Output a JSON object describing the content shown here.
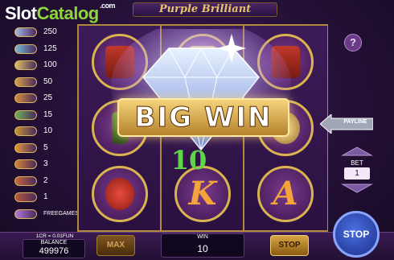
{
  "brand": {
    "slot": "Slot",
    "catalog": "Catalog",
    "com": ".com"
  },
  "game_title": "Purple Brilliant",
  "paytable": [
    {
      "value": "250",
      "icon": "diamond-bar-icon",
      "color": "#a8b8e8"
    },
    {
      "value": "125",
      "icon": "emerald-bar-icon",
      "color": "#7bbbd8"
    },
    {
      "value": "100",
      "icon": "crown-coin-icon",
      "color": "#e0c06a"
    },
    {
      "value": "50",
      "icon": "ring-coin-icon",
      "color": "#d9a44a"
    },
    {
      "value": "25",
      "icon": "watch-coin-icon",
      "color": "#d69040"
    },
    {
      "value": "15",
      "icon": "champagne-coin-icon",
      "color": "#6fae5c"
    },
    {
      "value": "10",
      "icon": "perfume-coin-icon",
      "color": "#c89638"
    },
    {
      "value": "5",
      "icon": "letter-a-coin-icon",
      "color": "#e39a3a"
    },
    {
      "value": "3",
      "icon": "letter-k-coin-icon",
      "color": "#d9833a"
    },
    {
      "value": "2",
      "icon": "letter-q-coin-icon",
      "color": "#c96a3a"
    },
    {
      "value": "1",
      "icon": "letter-j-coin-icon",
      "color": "#b85a3a"
    },
    {
      "value": "FREEGAMES",
      "icon": "diamond-scatter-icon",
      "color": "#b07ad8"
    }
  ],
  "big_win": {
    "label_big": "BIG",
    "label_win": "WIN",
    "amount": "10"
  },
  "controls": {
    "help": "?",
    "payline": "PAYLINE",
    "bet_label": "BET",
    "bet_value": "1"
  },
  "bottom": {
    "credit_info": "1CR = 0.01FUN",
    "balance_label": "BALANCE",
    "balance_value": "499976",
    "max_label": "MAX",
    "win_label": "WIN",
    "win_value": "10",
    "stop_small_label": "STOP",
    "stop_big_label": "STOP"
  },
  "colors": {
    "accent_gold": "#d9b450",
    "win_green": "#5fd64a",
    "brand_green": "#8fd63c",
    "stop_blue": "#1b2f8a"
  }
}
